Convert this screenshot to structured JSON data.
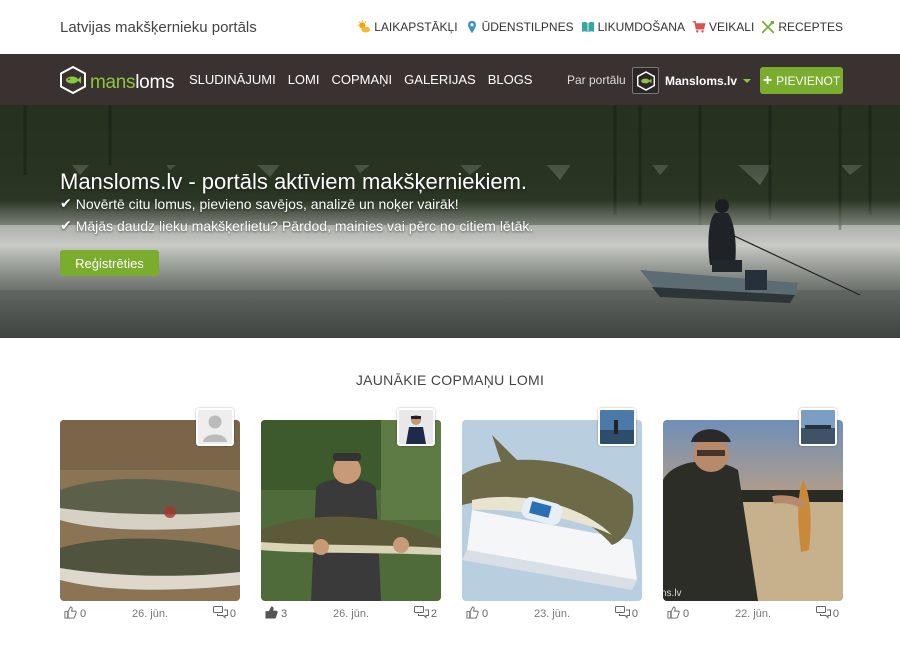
{
  "topbar": {
    "site_name": "Latvijas makšķernieku portāls",
    "links": [
      {
        "label": "LAIKAPSTĀKĻI",
        "icon": "weather-icon"
      },
      {
        "label": "ŪDENSTILPNES",
        "icon": "map-pin-icon"
      },
      {
        "label": "LIKUMDOŠANA",
        "icon": "book-icon"
      },
      {
        "label": "VEIKALI",
        "icon": "cart-icon"
      },
      {
        "label": "RECEPTES",
        "icon": "utensils-icon"
      }
    ]
  },
  "nav": {
    "logo_prefix": "mans",
    "logo_suffix": "loms",
    "items": [
      "SLUDINĀJUMI",
      "LOMI",
      "COPMAŅI",
      "GALERIJAS",
      "BLOGS"
    ],
    "about_label": "Par portālu",
    "account_name": "Mansloms.lv",
    "add_plus": "+",
    "add_label": "PIEVIENOT"
  },
  "hero": {
    "title": "Mansloms.lv - portāls aktīviem makšķerniekiem.",
    "check": "✔",
    "line1": "Novērtē citu lomus, pievieno savējos, analizē un noķer vairāk!",
    "line2": "Mājās daudz lieku makšķerlietu? Pārdod, mainies vai pērc no citiem lētāk.",
    "register_label": "Reģistrēties"
  },
  "catches": {
    "title": "JAUNĀKIE COPMAŅU LOMI",
    "items": [
      {
        "likes": "0",
        "date": "26. jūn.",
        "comments": "0"
      },
      {
        "likes": "3",
        "date": "26. jūn.",
        "comments": "2"
      },
      {
        "likes": "0",
        "date": "23. jūn.",
        "comments": "0"
      },
      {
        "likes": "0",
        "date": "22. jūn.",
        "comments": "0"
      }
    ],
    "watermark": "ns.lv"
  },
  "colors": {
    "accent_green": "#7aad2e",
    "nav_bg": "#3a3230",
    "logo_green": "#8cc63f"
  }
}
